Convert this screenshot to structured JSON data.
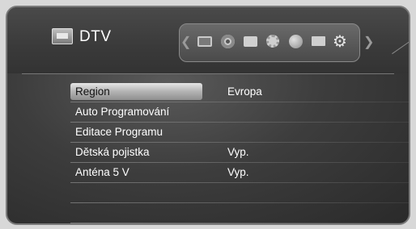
{
  "header": {
    "title": "DTV",
    "categories": [
      {
        "icon": "tv-icon",
        "active": true
      },
      {
        "icon": "disc-icon",
        "active": false
      },
      {
        "icon": "photo-icon",
        "active": false
      },
      {
        "icon": "music-icon",
        "active": false
      },
      {
        "icon": "network-icon",
        "active": false
      },
      {
        "icon": "folder-icon",
        "active": false
      },
      {
        "icon": "settings-gear-icon",
        "active": false
      }
    ]
  },
  "menu": {
    "items": [
      {
        "label": "Region",
        "value": "Evropa",
        "selected": true
      },
      {
        "label": "Auto Programování",
        "value": ""
      },
      {
        "label": "Editace Programu",
        "value": ""
      },
      {
        "label": "Dětská pojistka",
        "value": "Vyp."
      },
      {
        "label": "Anténa 5 V",
        "value": "Vyp."
      }
    ]
  },
  "colors": {
    "background": "#3d3d3d",
    "text": "#ffffff",
    "highlight": "#c8c8c8",
    "highlight_text": "#111111"
  }
}
